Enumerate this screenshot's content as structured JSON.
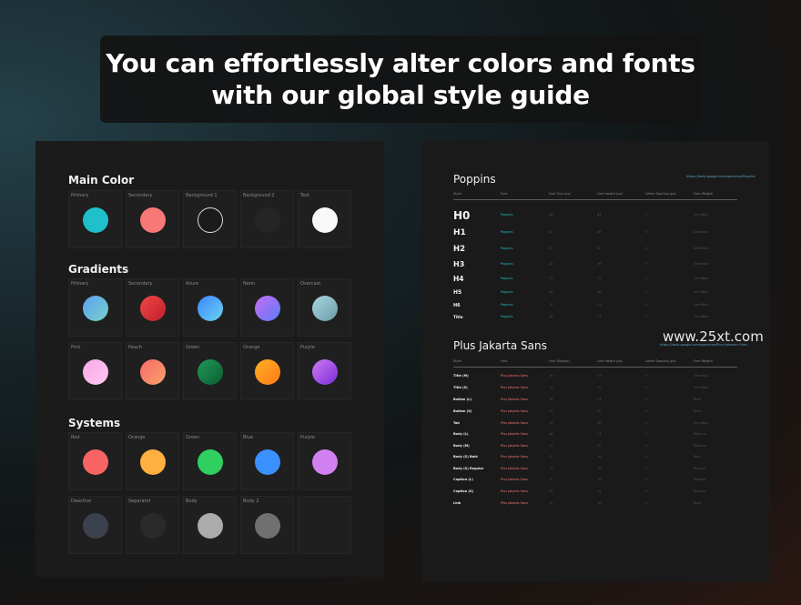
{
  "headline": {
    "line1": "You can effortlessly alter colors and fonts",
    "line2": "with our global style guide"
  },
  "watermark": "www.25xt.com",
  "left_panel": {
    "main_color": {
      "title": "Main Color",
      "swatches": [
        {
          "label": "Primary",
          "color": "#1fbfcc"
        },
        {
          "label": "Secondary",
          "color": "#f87878"
        },
        {
          "label": "Background 1",
          "color": "#1b1b1b",
          "outline": true
        },
        {
          "label": "Background 2",
          "color": "#252525"
        },
        {
          "label": "Text",
          "color": "#f8f8f8"
        }
      ]
    },
    "gradients": {
      "title": "Gradients",
      "swatches": [
        {
          "label": "Primary",
          "from": "#5aa2f2",
          "to": "#7ad0c8"
        },
        {
          "label": "Secondary",
          "from": "#f04848",
          "to": "#c01e2a"
        },
        {
          "label": "Azure",
          "from": "#3a86ff",
          "to": "#6cd3f0"
        },
        {
          "label": "Neon",
          "from": "#c86cf5",
          "to": "#5a7cf5"
        },
        {
          "label": "Overcast",
          "from": "#a9d8de",
          "to": "#6a9aa8"
        },
        {
          "label": "Pink",
          "from": "#f8a8e8",
          "to": "#ffc8f0"
        },
        {
          "label": "Peach",
          "from": "#f86a6a",
          "to": "#f8a06a"
        },
        {
          "label": "Green",
          "from": "#1e9a58",
          "to": "#0b5e30"
        },
        {
          "label": "Orange",
          "from": "#ffb020",
          "to": "#ff7a1a"
        },
        {
          "label": "Purple",
          "from": "#d07af5",
          "to": "#7a2ed6"
        }
      ]
    },
    "systems": {
      "title": "Systems",
      "swatches": [
        {
          "label": "Red",
          "color": "#f86464"
        },
        {
          "label": "Orange",
          "color": "#ffb040"
        },
        {
          "label": "Green",
          "color": "#30d060"
        },
        {
          "label": "Blue",
          "color": "#3a90ff"
        },
        {
          "label": "Purple",
          "color": "#d080f0"
        },
        {
          "label": "Deactive",
          "color": "#3c414e"
        },
        {
          "label": "Separator",
          "color": "#2a2a2a"
        },
        {
          "label": "Body",
          "color": "#ababab"
        },
        {
          "label": "Body 2",
          "color": "#707070"
        },
        {
          "label": "",
          "color": ""
        }
      ]
    }
  },
  "right_panel": {
    "poppins": {
      "title": "Poppins",
      "link": "https://fonts.google.com/specimen/Poppins",
      "headers": [
        "Style",
        "Font",
        "Font Size (px)",
        "Line Height (px)",
        "Letter Spacing (px)",
        "Font Weight"
      ],
      "rows": [
        {
          "style": "H0",
          "font": "Poppins",
          "size": "56",
          "lh": "64",
          "ls": "0",
          "weight": "SemiBold"
        },
        {
          "style": "H1",
          "font": "Poppins",
          "size": "40",
          "lh": "48",
          "ls": "0",
          "weight": "SemiBold"
        },
        {
          "style": "H2",
          "font": "Poppins",
          "size": "32",
          "lh": "40",
          "ls": "0",
          "weight": "SemiBold"
        },
        {
          "style": "H3",
          "font": "Poppins",
          "size": "28",
          "lh": "36",
          "ls": "0",
          "weight": "SemiBold"
        },
        {
          "style": "H4",
          "font": "Poppins",
          "size": "24",
          "lh": "32",
          "ls": "0",
          "weight": "SemiBold"
        },
        {
          "style": "H5",
          "font": "Poppins",
          "size": "20",
          "lh": "28",
          "ls": "0",
          "weight": "SemiBold"
        },
        {
          "style": "H6",
          "font": "Poppins",
          "size": "18",
          "lh": "24",
          "ls": "0",
          "weight": "SemiBold"
        },
        {
          "style": "Title",
          "font": "Poppins",
          "size": "16",
          "lh": "24",
          "ls": "0",
          "weight": "SemiBold"
        }
      ]
    },
    "jakarta": {
      "title": "Plus Jakarta Sans",
      "link": "https://fonts.google.com/specimen/Plus+Jakarta+Sans",
      "headers": [
        "Style",
        "Font",
        "Font Size(px)",
        "Line Height (px)",
        "Letter Spacing (px)",
        "Font Weight"
      ],
      "rows": [
        {
          "style": "Title (M)",
          "font": "Plus Jakarta Sans",
          "size": "16",
          "lh": "24",
          "ls": "0",
          "weight": "SemiBold"
        },
        {
          "style": "Title (S)",
          "font": "Plus Jakarta Sans",
          "size": "14",
          "lh": "20",
          "ls": "0",
          "weight": "SemiBold"
        },
        {
          "style": "Button (L)",
          "font": "Plus Jakarta Sans",
          "size": "16",
          "lh": "24",
          "ls": "0",
          "weight": "Bold"
        },
        {
          "style": "Button (S)",
          "font": "Plus Jakarta Sans",
          "size": "14",
          "lh": "20",
          "ls": "0",
          "weight": "Bold"
        },
        {
          "style": "Tab",
          "font": "Plus Jakarta Sans",
          "size": "14",
          "lh": "20",
          "ls": "0",
          "weight": "SemiBold"
        },
        {
          "style": "Body (L)",
          "font": "Plus Jakarta Sans",
          "size": "16",
          "lh": "24",
          "ls": "0",
          "weight": "Medium"
        },
        {
          "style": "Body (M)",
          "font": "Plus Jakarta Sans",
          "size": "14",
          "lh": "20",
          "ls": "0",
          "weight": "Medium"
        },
        {
          "style": "Body (S) Bold",
          "font": "Plus Jakarta Sans",
          "size": "12",
          "lh": "16",
          "ls": "0",
          "weight": "Bold"
        },
        {
          "style": "Body (S) Regular",
          "font": "Plus Jakarta Sans",
          "size": "12",
          "lh": "16",
          "ls": "0",
          "weight": "Regular"
        },
        {
          "style": "Caption (L)",
          "font": "Plus Jakarta Sans",
          "size": "12",
          "lh": "16",
          "ls": "0",
          "weight": "Regular"
        },
        {
          "style": "Caption (S)",
          "font": "Plus Jakarta Sans",
          "size": "10",
          "lh": "14",
          "ls": "0",
          "weight": "Regular"
        },
        {
          "style": "Link",
          "font": "Plus Jakarta Sans",
          "size": "12",
          "lh": "16",
          "ls": "0",
          "weight": "Bold"
        }
      ]
    }
  }
}
